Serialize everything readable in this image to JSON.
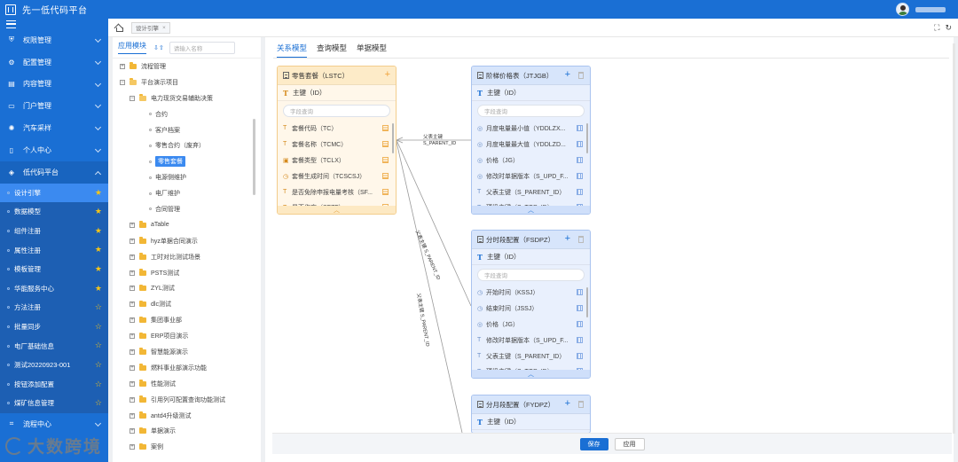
{
  "app": {
    "title": "先一低代码平台"
  },
  "sidebar": {
    "menu": [
      {
        "label": "权限管理",
        "icon": "shield-icon"
      },
      {
        "label": "配置管理",
        "icon": "gear-icon"
      },
      {
        "label": "内容管理",
        "icon": "box-icon"
      },
      {
        "label": "门户管理",
        "icon": "portal-icon"
      },
      {
        "label": "汽车采样",
        "icon": "settings-icon"
      },
      {
        "label": "个人中心",
        "icon": "doc-icon"
      },
      {
        "label": "低代码平台",
        "icon": "layers-icon"
      }
    ],
    "submenu": [
      {
        "label": "设计引擎",
        "star": "filled"
      },
      {
        "label": "数据模型",
        "star": "filled"
      },
      {
        "label": "组件注册",
        "star": "filled"
      },
      {
        "label": "属性注册",
        "star": "filled"
      },
      {
        "label": "模板管理",
        "star": "filled"
      },
      {
        "label": "华能服务中心",
        "star": "filled"
      },
      {
        "label": "方法注册",
        "star": "empty"
      },
      {
        "label": "批量同步",
        "star": "empty"
      },
      {
        "label": "电厂基础信息",
        "star": "empty"
      },
      {
        "label": "测试20220923-001",
        "star": "empty"
      },
      {
        "label": "按钮添加配置",
        "star": "empty"
      },
      {
        "label": "煤矿信息管理",
        "star": "empty"
      }
    ],
    "footer_menu": [
      {
        "label": "流程中心",
        "icon": "flow-icon"
      }
    ],
    "watermark": "大数跨境"
  },
  "header": {
    "tab_label": "设计引擎"
  },
  "left_panel": {
    "title": "应用模块",
    "search_placeholder": "请输入名称",
    "tree": [
      {
        "label": "流程管理",
        "kind": "folder",
        "level": 0
      },
      {
        "label": "平台演示项目",
        "kind": "folder-open",
        "level": 0
      },
      {
        "label": "电力现货交易辅助决策",
        "kind": "folder-open",
        "level": 1
      },
      {
        "label": "合约",
        "kind": "leaf",
        "level": 2
      },
      {
        "label": "客户档案",
        "kind": "leaf",
        "level": 2
      },
      {
        "label": "零售合约（废弃）",
        "kind": "leaf",
        "level": 2
      },
      {
        "label": "零售套餐",
        "kind": "leaf-selected",
        "level": 2
      },
      {
        "label": "电源侧维护",
        "kind": "leaf",
        "level": 2
      },
      {
        "label": "电厂维护",
        "kind": "leaf",
        "level": 2
      },
      {
        "label": "合同管理",
        "kind": "leaf",
        "level": 2
      },
      {
        "label": "aTable",
        "kind": "folder",
        "level": 1
      },
      {
        "label": "hyz单据合同演示",
        "kind": "folder",
        "level": 1
      },
      {
        "label": "工时对比测试场景",
        "kind": "folder",
        "level": 1
      },
      {
        "label": "PSTS测试",
        "kind": "folder",
        "level": 1
      },
      {
        "label": "ZYL测试",
        "kind": "folder",
        "level": 1
      },
      {
        "label": "dlc测试",
        "kind": "folder",
        "level": 1
      },
      {
        "label": "集团事业部",
        "kind": "folder",
        "level": 1
      },
      {
        "label": "ERP项目演示",
        "kind": "folder",
        "level": 1
      },
      {
        "label": "智慧能源演示",
        "kind": "folder",
        "level": 1
      },
      {
        "label": "燃料事业部演示功能",
        "kind": "folder",
        "level": 1
      },
      {
        "label": "性能测试",
        "kind": "folder",
        "level": 1
      },
      {
        "label": "引用列可配置查询功能测试",
        "kind": "folder",
        "level": 1
      },
      {
        "label": "antd4升级测试",
        "kind": "folder",
        "level": 1
      },
      {
        "label": "单据演示",
        "kind": "folder",
        "level": 1
      },
      {
        "label": "案例",
        "kind": "folder",
        "level": 1
      }
    ]
  },
  "canvas": {
    "tabs": [
      "关系模型",
      "查询模型",
      "单据模型"
    ],
    "search_placeholder": "字段查询",
    "entities": [
      {
        "title": "零售套餐（LSTC）",
        "pk": "主键（ID）",
        "fields": [
          {
            "icon": "T",
            "label": "套餐代码（TC）"
          },
          {
            "icon": "T",
            "label": "套餐名称（TCMC）"
          },
          {
            "icon": "▣",
            "label": "套餐类型（TCLX）"
          },
          {
            "icon": "◷",
            "label": "套餐生成时间（TCSCSJ）"
          },
          {
            "icon": "T",
            "label": "是否免除申报电量考核（SF..."
          },
          {
            "icon": "T",
            "label": "是否作废（SFZF）"
          }
        ]
      },
      {
        "title": "阶梯价格表（JTJGB）",
        "pk": "主键（ID）",
        "fields": [
          {
            "icon": "◎",
            "label": "月度电量最小值（YDDLZX..."
          },
          {
            "icon": "◎",
            "label": "月度电量最大值（YDDLZD..."
          },
          {
            "icon": "◎",
            "label": "价格（JG）"
          },
          {
            "icon": "◎",
            "label": "修改时单据版本（S_UPD_F..."
          },
          {
            "icon": "T",
            "label": "父表主键（S_PARENT_ID）"
          },
          {
            "icon": "T",
            "label": "顶级主键（S_TOP_ID）"
          }
        ]
      },
      {
        "title": "分时段配置（FSDPZ）",
        "pk": "主键（ID）",
        "fields": [
          {
            "icon": "◷",
            "label": "开始时间（KSSJ）"
          },
          {
            "icon": "◷",
            "label": "结束时间（JSSJ）"
          },
          {
            "icon": "◎",
            "label": "价格（JG）"
          },
          {
            "icon": "T",
            "label": "修改时单据版本（S_UPD_F..."
          },
          {
            "icon": "T",
            "label": "父表主键（S_PARENT_ID）"
          },
          {
            "icon": "T",
            "label": "顶级主键（S_TOP_ID）"
          }
        ]
      },
      {
        "title": "分月段配置（FYDPZ）",
        "pk": "主键（ID）",
        "fields": []
      }
    ],
    "relations": [
      {
        "label_a": "父表主键",
        "label_b": "S_PARENT_ID"
      },
      {
        "label_a": "父表主键",
        "label_b": "S_PARENT_ID"
      },
      {
        "label_a": "父表主键",
        "label_b": "S_PARENT_ID"
      }
    ]
  },
  "footer": {
    "save": "保存",
    "apply": "应用"
  },
  "colors": {
    "brand": "#1a6fd4",
    "entity_main": "#fff7ea",
    "entity_child": "#e9f0fd",
    "star": "#f5c518"
  }
}
